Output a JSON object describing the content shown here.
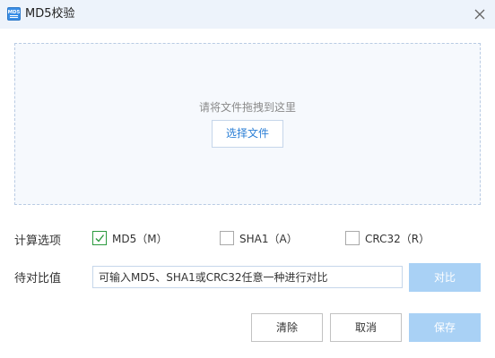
{
  "window": {
    "title": "MD5校验",
    "icon": "md5-app-icon",
    "icon_text": "MD5",
    "close_icon": "close-icon"
  },
  "dropzone": {
    "hint": "请将文件拖拽到这里",
    "choose_button": "选择文件"
  },
  "options": {
    "label": "计算选项",
    "items": [
      {
        "label": "MD5（M）",
        "checked": true
      },
      {
        "label": "SHA1（A）",
        "checked": false
      },
      {
        "label": "CRC32（R）",
        "checked": false
      }
    ]
  },
  "compare": {
    "label": "待对比值",
    "placeholder": "可输入MD5、SHA1或CRC32任意一种进行对比",
    "value": "",
    "compare_button": "对比"
  },
  "footer": {
    "clear_button": "清除",
    "cancel_button": "取消",
    "save_button": "保存"
  },
  "colors": {
    "accent": "#2b7fd6",
    "disabled_button": "#a9d1f5",
    "checkbox_checked": "#2b9a3e",
    "titlebar": "#edf3fb"
  }
}
